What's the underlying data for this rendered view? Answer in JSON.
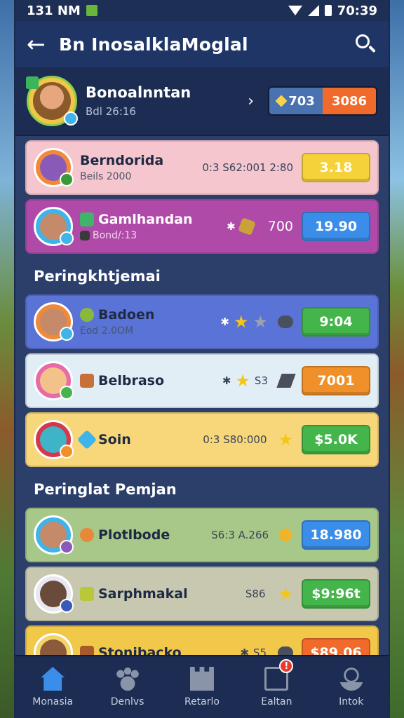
{
  "status_bar": {
    "time": "131 NM",
    "clock": "70:39"
  },
  "app_bar": {
    "title": "Bn InosalklaMoglal"
  },
  "profile": {
    "name": "Bonoalnntan",
    "subtitle": "Bdl 26:16",
    "gems": "703",
    "coins": "3086"
  },
  "top_rows": [
    {
      "name": "Berndorida",
      "sub": "Beils 2000",
      "meta": "0:3 S62:001 2:80",
      "action": "3.18",
      "bg": "#f6c6cf",
      "btn": "#f5d23a",
      "btntext": "#ffffff",
      "avatar": "#f08a3a",
      "face": "#8a5ab8",
      "mini": "#3a9a3a"
    },
    {
      "name": "Gamlhandan",
      "sub": "Bond/:13",
      "meta": "700",
      "action": "19.90",
      "bg": "#b04aa8",
      "btn": "#3a8de8",
      "btntext": "#ffffff",
      "avatar": "#3fb4e8",
      "face": "#c48a6a",
      "mini": "#3fb4e8",
      "dark": true
    }
  ],
  "section1": {
    "title": "Peringkhtjemai"
  },
  "mid_rows": [
    {
      "name": "Badoen",
      "sub": "Eod 2.0OM",
      "action": "9:04",
      "bg": "#5a73d6",
      "btn": "#44b54a",
      "avatar": "#f08a3a",
      "face": "#c48a6a",
      "mini": "#3fb4e8"
    },
    {
      "name": "Belbraso",
      "sub": "",
      "meta": "S3",
      "action": "7001",
      "bg": "#e2eef6",
      "btn": "#f0902a",
      "avatar": "#e86aa8",
      "face": "#f2c28a",
      "mini": "#44b54a"
    },
    {
      "name": "Soin",
      "sub": "",
      "meta": "0:3 S80:000",
      "action": "$5.0K",
      "bg": "#f7d77a",
      "btn": "#44b54a",
      "avatar": "#d6384a",
      "face": "#3fb4c8",
      "mini": "#f0902a"
    }
  ],
  "section2": {
    "title": "Peringlat Pemjan"
  },
  "bottom_rows": [
    {
      "name": "Plotlbode",
      "meta": "S6:3 A.266",
      "action": "18.980",
      "bg": "#a8c88a",
      "btn": "#3a8de8",
      "avatar": "#3fb4e8",
      "face": "#c48a6a",
      "mini": "#8a5ab8"
    },
    {
      "name": "Sarphmakal",
      "meta": "S86",
      "action": "$9:96t",
      "bg": "#c8c8b0",
      "btn": "#44b54a",
      "avatar": "#e8e8f0",
      "face": "#6a4a3a",
      "mini": "#3a5ab8"
    },
    {
      "name": "Stonibacko",
      "meta": "S5",
      "action": "$89.06",
      "bg": "#f2c84a",
      "btn": "#f06a2b",
      "avatar": "#f2d46a",
      "face": "#8a5a3a",
      "mini": "#f0902a"
    }
  ],
  "nav": [
    {
      "label": "Monasia",
      "icon": "home-icon"
    },
    {
      "label": "Denlvs",
      "icon": "paw-icon"
    },
    {
      "label": "Retarlo",
      "icon": "castle-icon"
    },
    {
      "label": "Ealtan",
      "icon": "edit-icon",
      "badge": "!"
    },
    {
      "label": "Intok",
      "icon": "profile-icon"
    }
  ]
}
